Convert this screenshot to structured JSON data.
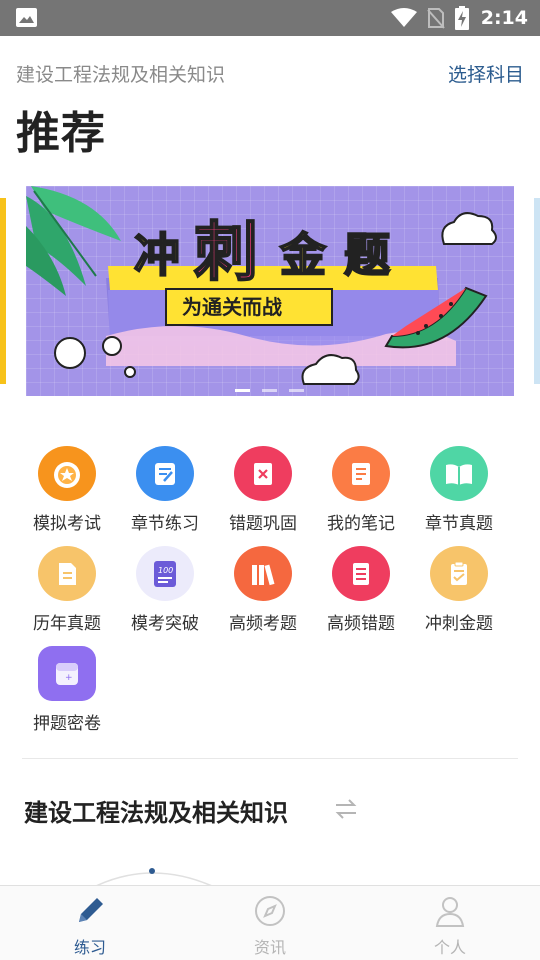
{
  "status_bar": {
    "time": "2:14"
  },
  "header": {
    "subtitle": "建设工程法规及相关知识",
    "select_subject": "选择科目",
    "title": "推荐"
  },
  "banner": {
    "title_chars": [
      "冲",
      "刺",
      "金",
      "题"
    ],
    "slogan": "为通关而战",
    "active_index": 0,
    "dot_count": 3
  },
  "grid": {
    "items": [
      {
        "label": "模拟考试",
        "icon": "medal-icon",
        "color": "#f7941d"
      },
      {
        "label": "章节练习",
        "icon": "edit-doc-icon",
        "color": "#3b8ff0"
      },
      {
        "label": "错题巩固",
        "icon": "wrong-doc-icon",
        "color": "#ef3d5f"
      },
      {
        "label": "我的笔记",
        "icon": "note-icon",
        "color": "#fb7c45"
      },
      {
        "label": "章节真题",
        "icon": "book-icon",
        "color": "#4fd6a5"
      },
      {
        "label": "历年真题",
        "icon": "doc-icon",
        "color": "#f7c46a"
      },
      {
        "label": "模考突破",
        "icon": "score-icon",
        "color": "#6b5bd8"
      },
      {
        "label": "高频考题",
        "icon": "books-icon",
        "color": "#f5683f"
      },
      {
        "label": "高频错题",
        "icon": "list-doc-icon",
        "color": "#ef3d5f"
      },
      {
        "label": "冲刺金题",
        "icon": "clipboard-icon",
        "color": "#f7c46a"
      },
      {
        "label": "押题密卷",
        "icon": "secret-paper-icon",
        "color": "#8f6ff0"
      }
    ]
  },
  "section": {
    "title": "建设工程法规及相关知识"
  },
  "tabbar": {
    "tabs": [
      {
        "label": "练习",
        "icon": "pencil-icon",
        "active": true
      },
      {
        "label": "资讯",
        "icon": "compass-icon",
        "active": false
      },
      {
        "label": "个人",
        "icon": "person-icon",
        "active": false
      }
    ]
  },
  "colors": {
    "accent": "#2e5b91",
    "banner_bg": "#a394e8",
    "statusbar": "#757575"
  }
}
